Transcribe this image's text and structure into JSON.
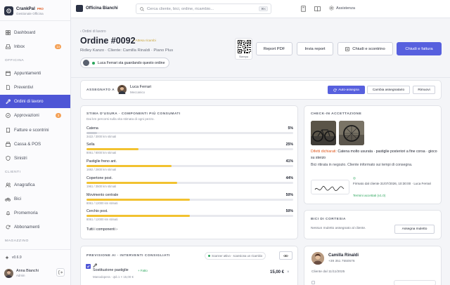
{
  "app": {
    "name": "CrankPal",
    "edition": "PRO",
    "subtitle": "Gestionale Officina"
  },
  "nav": {
    "items": [
      {
        "label": "Dashboard",
        "icon": "grid-icon"
      },
      {
        "label": "Inbox",
        "icon": "inbox-icon",
        "count": "14"
      },
      {
        "label": "Appuntamenti",
        "icon": "calendar-icon"
      },
      {
        "label": "Preventivi",
        "icon": "document-icon"
      },
      {
        "label": "Ordini di lavoro",
        "icon": "wrench-icon"
      },
      {
        "label": "Approvazioni",
        "icon": "check-circle-icon",
        "count": "3"
      },
      {
        "label": "Fatture e scontrini",
        "icon": "receipt-icon"
      },
      {
        "label": "Cassa & POS",
        "icon": "register-icon"
      },
      {
        "label": "Sinistri",
        "icon": "shield-icon"
      },
      {
        "label": "Anagrafica",
        "icon": "users-icon"
      },
      {
        "label": "Bici",
        "icon": "bike-icon"
      },
      {
        "label": "Promemoria",
        "icon": "bell-icon"
      },
      {
        "label": "Abbonamenti",
        "icon": "refresh-icon"
      }
    ],
    "sections": [
      "OFFICINA",
      "CLIENTI",
      "MAGAZZINO"
    ],
    "version": "v0.6.9"
  },
  "user": {
    "name": "Anna Bianchi",
    "role": "Admin"
  },
  "topbar": {
    "shop": "Officina Bianchi",
    "search_placeholder": "Cerca cliente, bici, ordine, ricambio...",
    "shortcut": "⌘K",
    "assist": "Assistenza"
  },
  "order": {
    "breadcrumb": "‹ Ordini di lavoro",
    "title": "Ordine #0092",
    "status": "• Attesa ricambi",
    "subtitle": "Ridley Kanzo · Cliente: Camilla Rinaldi · Piano Plus",
    "watching": "Luca Ferrari sta guardando questo ordine",
    "qr_label": "Stampa",
    "buttons": {
      "report": "Report PDF",
      "send": "Invia report",
      "close_receipt": "Chiudi e scontrino",
      "close_invoice": "Chiudi e fattura"
    }
  },
  "assign": {
    "label": "ASSEGNATO A",
    "name": "Luca Ferrari",
    "role": "Meccanico",
    "auto": "Auto-assegna",
    "change": "Cambia assegnatario",
    "remove": "Rimuovi"
  },
  "wear": {
    "title": "STIMA D'USURA · COMPONENTI PIÙ CONSUMATI",
    "subtitle": "Dai km percorsi sulla vita stimata di ogni pezzo.",
    "items": [
      {
        "name": "Catena",
        "pct": "5%",
        "value": 5,
        "km": "3422 / 3000 km stimati",
        "color": "#c9ccd4"
      },
      {
        "name": "Sella",
        "pct": "25%",
        "value": 25,
        "km": "8061 / 8000 km stimati",
        "color": "#f2c230"
      },
      {
        "name": "Pastiglie freno ant.",
        "pct": "41%",
        "value": 41,
        "km": "1692 / 2800 km stimati",
        "color": "#f2c230"
      },
      {
        "name": "Copertone post.",
        "pct": "44%",
        "value": 44,
        "km": "1961 / 3500 km stimati",
        "color": "#f2c230"
      },
      {
        "name": "Movimento centrale",
        "pct": "50%",
        "value": 50,
        "km": "8061 / 12000 km stimati",
        "color": "#f2c230"
      },
      {
        "name": "Cerchio post.",
        "pct": "50%",
        "value": 50,
        "km": "8061 / 12000 km stimati",
        "color": "#f2c230"
      }
    ],
    "all_link": "Tutti i componenti ›"
  },
  "checkin": {
    "title": "CHECK-IN ACCETTAZIONE",
    "defects_label": "Difetti dichiarati:",
    "defects": "Catena molto usurata · pastiglie posteriori a fine corsa · gioco su sterzo",
    "pickup": "Bici ritirata in negozio. Cliente informato sui tempi di consegna.",
    "signed": "Firmato dal cliente  31/07/2026, 10:30:00 · Luca Ferrari",
    "terms": "Termini accettati (v1.0)"
  },
  "courtesy": {
    "title": "BICI DI CORTESIA",
    "text": "Nessun muletto assegnato al cliente.",
    "button": "Assegna muletto"
  },
  "prediction": {
    "title": "PREVISIONE AI · INTERVENTI CONSIGLIATI",
    "scan": "Scanner attivo · scansiona un ricambio",
    "item": "Sostituzione pastiglie",
    "tag": "+ Fatto",
    "detail": "Manodopera · qtà 1 × 15,00 €",
    "price": "15,00 €"
  },
  "customer": {
    "name": "Camilla Rinaldi",
    "phone": "+39 351 7550576",
    "since": "Cliente dal 11/11/2025"
  },
  "colors": {
    "accent": "#5760de",
    "warn": "#f2c230",
    "danger": "#e0591f"
  }
}
